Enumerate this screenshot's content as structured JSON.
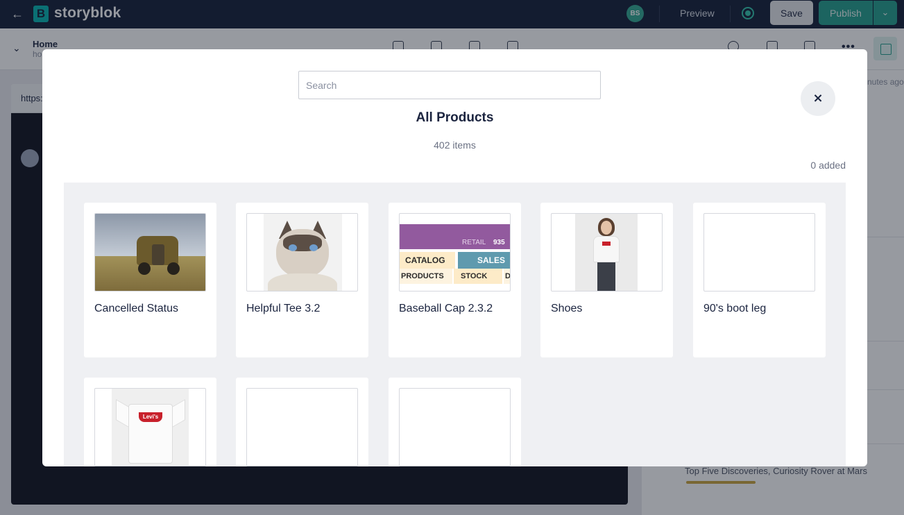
{
  "topbar": {
    "logo_letter": "B",
    "app_name": "storyblok",
    "user_initials": "BS",
    "preview_label": "Preview",
    "save_label": "Save",
    "publish_label": "Publish"
  },
  "editor": {
    "story_title": "Home",
    "story_slug": "ho",
    "url_text": "https:"
  },
  "right_panel": {
    "timestamp_partial": "nutes ago",
    "story_item": "Top Five Discoveries, Curiosity Rover at Mars"
  },
  "modal": {
    "search_placeholder": "Search",
    "close_symbol": "×",
    "title": "All Products",
    "item_count": "402 items",
    "added_count": "0 added",
    "business_thumb": {
      "retail": "RETAIL",
      "retail_value": "935",
      "catalog": "CATALOG",
      "sales": "SALES",
      "products": "PRODUCTS",
      "stock": "STOCK",
      "d": "D"
    },
    "tee_logo": "Levi's",
    "products": [
      {
        "name": "Cancelled Status",
        "image": "vintage-truck-photo"
      },
      {
        "name": "Helpful Tee 3.2",
        "image": "grumpy-cat-photo"
      },
      {
        "name": "Baseball Cap 2.3.2",
        "image": "business-terms-graphic"
      },
      {
        "name": "Shoes",
        "image": "model-tshirt-photo"
      },
      {
        "name": "90's boot leg",
        "image": "empty-thumbnail"
      },
      {
        "name": "",
        "image": "white-tshirt-photo"
      },
      {
        "name": "",
        "image": "empty-thumbnail"
      },
      {
        "name": "",
        "image": "empty-thumbnail"
      }
    ]
  }
}
